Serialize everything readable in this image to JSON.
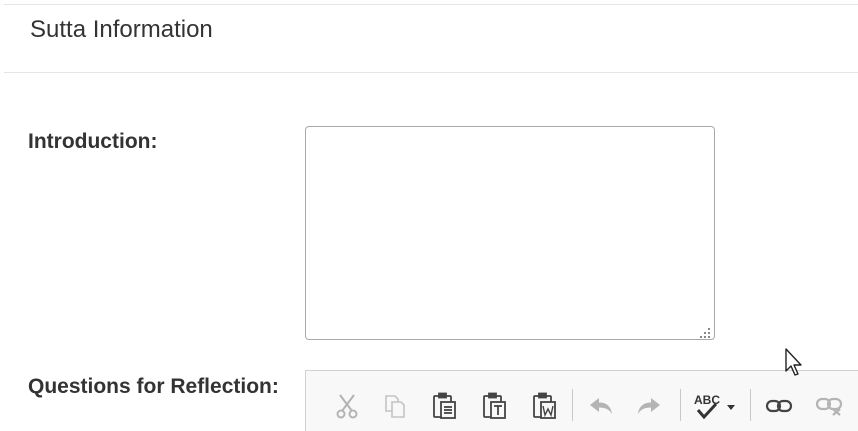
{
  "section": {
    "title": "Sutta Information"
  },
  "fields": {
    "introduction": {
      "label": "Introduction:",
      "value": ""
    },
    "questions": {
      "label": "Questions for Reflection:"
    }
  },
  "toolbar": {
    "buttons": [
      {
        "name": "cut",
        "icon": "scissors-icon",
        "enabled": false
      },
      {
        "name": "copy",
        "icon": "copy-icon",
        "enabled": false
      },
      {
        "name": "paste",
        "icon": "paste-icon",
        "enabled": true
      },
      {
        "name": "paste-text",
        "icon": "paste-text-icon",
        "enabled": true
      },
      {
        "name": "paste-word",
        "icon": "paste-from-word-icon",
        "enabled": true
      },
      {
        "name": "undo",
        "icon": "undo-icon",
        "enabled": false
      },
      {
        "name": "redo",
        "icon": "redo-icon",
        "enabled": false
      },
      {
        "name": "spellcheck",
        "icon": "spellcheck-icon",
        "enabled": true
      },
      {
        "name": "link",
        "icon": "link-icon",
        "enabled": true
      },
      {
        "name": "unlink",
        "icon": "unlink-icon",
        "enabled": false
      }
    ],
    "colors": {
      "enabled": "#333333",
      "disabled": "#b4b4b4"
    }
  }
}
